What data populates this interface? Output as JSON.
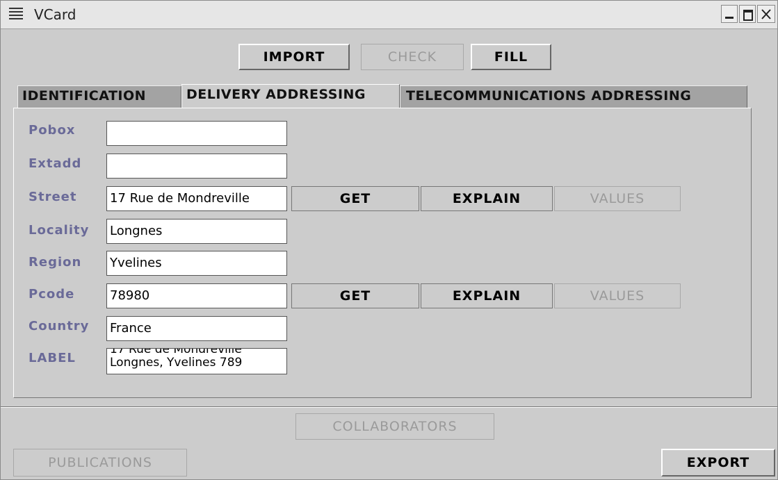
{
  "window": {
    "title": "VCard",
    "controls": [
      "minimize-icon",
      "maximize-icon",
      "close-icon"
    ]
  },
  "toolbar": {
    "import_label": "IMPORT",
    "check_label": "CHECK",
    "fill_label": "FILL"
  },
  "tabs": [
    {
      "label": "IDENTIFICATION",
      "active": false
    },
    {
      "label": "DELIVERY ADDRESSING",
      "active": true
    },
    {
      "label": "TELECOMMUNICATIONS ADDRESSING",
      "active": false
    }
  ],
  "fields": {
    "pobox": {
      "label": "Pobox",
      "value": ""
    },
    "extadd": {
      "label": "Extadd",
      "value": ""
    },
    "street": {
      "label": "Street",
      "value": "17 Rue de Mondreville"
    },
    "locality": {
      "label": "Locality",
      "value": "Longnes"
    },
    "region": {
      "label": "Region",
      "value": "Yvelines"
    },
    "pcode": {
      "label": "Pcode",
      "value": "78980"
    },
    "country": {
      "label": "Country",
      "value": "France"
    },
    "label": {
      "label": "LABEL",
      "value": "17 Rue de Mondreville\nLongnes, Yvelines 789"
    }
  },
  "row_buttons": {
    "get_label": "GET",
    "explain_label": "EXPLAIN",
    "values_label": "VALUES"
  },
  "footer": {
    "collaborators_label": "COLLABORATORS",
    "publications_label": "PUBLICATIONS",
    "export_label": "EXPORT"
  },
  "colors": {
    "background": "#cccccc",
    "field_label": "#6a6a98",
    "inactive_tab": "#a3a3a3",
    "disabled_text": "#9a9a9a"
  }
}
